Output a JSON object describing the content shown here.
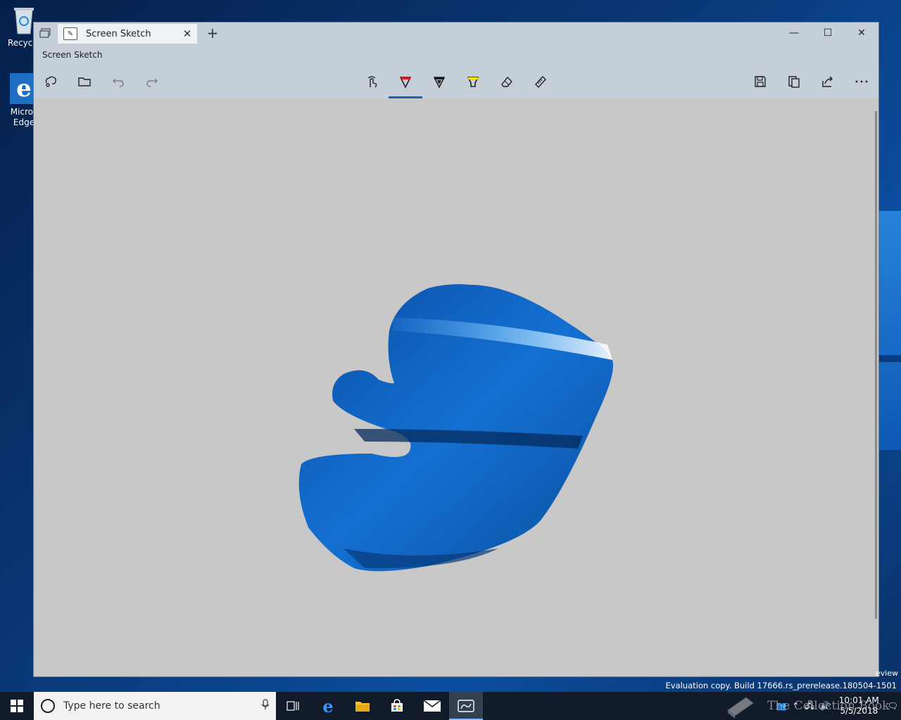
{
  "desktop": {
    "icons": [
      {
        "label": "Recycle",
        "icon": "recycle-bin-icon"
      },
      {
        "label_line1": "Micros",
        "label_line2": "Edge",
        "icon": "edge-icon"
      }
    ],
    "watermark_preview": "eview",
    "evaluation_text": "Evaluation copy. Build 17666.rs_prerelease.180504-1501",
    "site_watermark": "The Collection Book"
  },
  "window": {
    "tab_title": "Screen Sketch",
    "app_title": "Screen Sketch",
    "controls": {
      "minimize": "—",
      "maximize": "☐",
      "close": "✕"
    },
    "tab_close": "✕",
    "tab_add": "+"
  },
  "toolbar": {
    "left": [
      "new-snip-icon",
      "open-folder-icon",
      "undo-icon",
      "redo-icon"
    ],
    "center": [
      "touch-writing-icon",
      "ballpoint-pen-icon",
      "pencil-icon",
      "highlighter-icon",
      "eraser-icon",
      "ruler-icon"
    ],
    "right": [
      "save-icon",
      "copy-icon",
      "share-icon",
      "more-icon"
    ],
    "active_tool": "ballpoint-pen-icon",
    "accent": "#1e63b5"
  },
  "canvas": {
    "background": "#c8c8c8",
    "snip_colors": [
      "#0b5fc4",
      "#1b7fe0",
      "#0a4f9c"
    ]
  },
  "taskbar": {
    "search_placeholder": "Type here to search",
    "apps": [
      "task-view-icon",
      "edge-icon",
      "file-explorer-icon",
      "store-icon",
      "mail-icon",
      "screen-sketch-icon"
    ],
    "active_app": "screen-sketch-icon",
    "time": "10:01 AM",
    "date": "5/5/2018"
  }
}
